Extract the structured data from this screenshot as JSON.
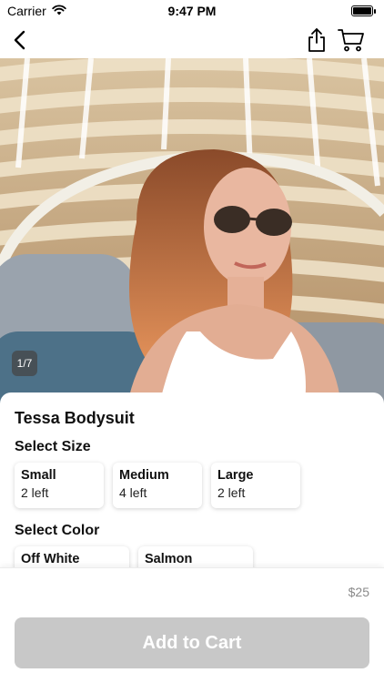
{
  "status_bar": {
    "carrier": "Carrier",
    "time": "9:47 PM",
    "battery_level": 1.0
  },
  "nav": {
    "back_icon": "chevron-left-icon",
    "share_icon": "share-icon",
    "cart_icon": "cart-icon"
  },
  "gallery": {
    "counter": "1/7"
  },
  "product": {
    "title": "Tessa Bodysuit",
    "size_section_label": "Select Size",
    "sizes": [
      {
        "name": "Small",
        "stock": "2 left"
      },
      {
        "name": "Medium",
        "stock": "4 left"
      },
      {
        "name": "Large",
        "stock": "2 left"
      }
    ],
    "color_section_label": "Select Color",
    "colors": [
      {
        "name": "Off White"
      },
      {
        "name": "Salmon"
      }
    ]
  },
  "footer": {
    "price": "$25",
    "add_to_cart_label": "Add to Cart",
    "button_color": "#c8c8c8"
  }
}
